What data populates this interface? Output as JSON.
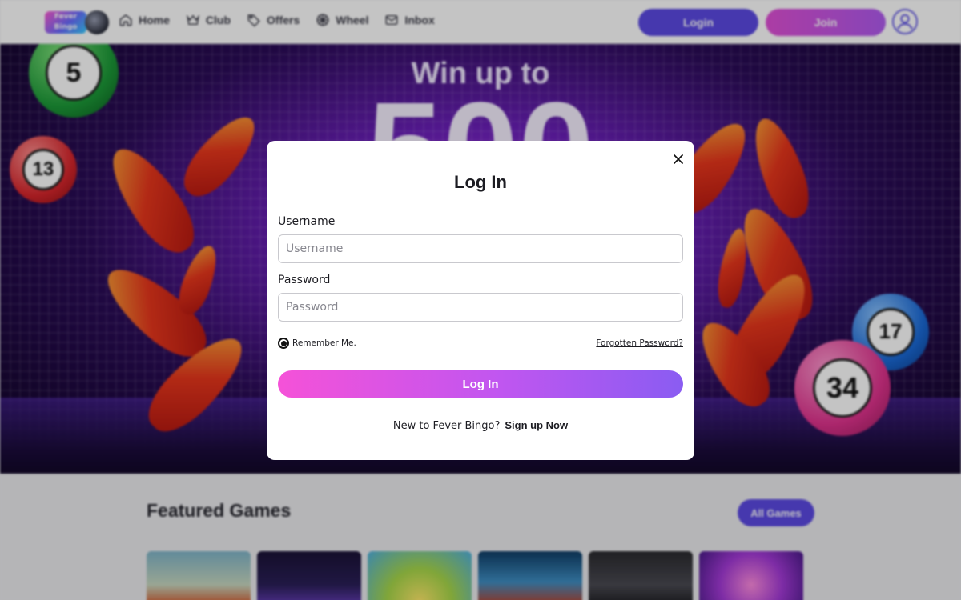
{
  "nav": {
    "logo_text": "Fever Bingo",
    "links": [
      {
        "label": "Home",
        "icon": "home-icon"
      },
      {
        "label": "Club",
        "icon": "crown-icon"
      },
      {
        "label": "Offers",
        "icon": "tag-icon"
      },
      {
        "label": "Wheel",
        "icon": "wheel-icon"
      },
      {
        "label": "Inbox",
        "icon": "mail-icon"
      }
    ],
    "login_label": "Login",
    "join_label": "Join",
    "colors": {
      "login": "#5b49e3",
      "join_start": "#e04fd6",
      "join_end": "#b05bf0"
    }
  },
  "hero": {
    "headline": "Win up to",
    "big_text": "500",
    "balls": [
      "5",
      "13",
      "17",
      "34"
    ]
  },
  "featured": {
    "title": "Featured Games",
    "all_games_label": "All Games"
  },
  "login_modal": {
    "title": "Log In",
    "username_label": "Username",
    "username_placeholder": "Username",
    "username_value": "",
    "password_label": "Password",
    "password_placeholder": "Password",
    "password_value": "",
    "remember_label": "Remember Me.",
    "remember_checked": true,
    "forgot_label": "Forgotten Password?",
    "submit_label": "Log In",
    "signup_prompt": "New to Fever Bingo?",
    "signup_link": "Sign up Now",
    "colors": {
      "submit_start": "#f552d8",
      "submit_end": "#8a5cf2"
    }
  }
}
